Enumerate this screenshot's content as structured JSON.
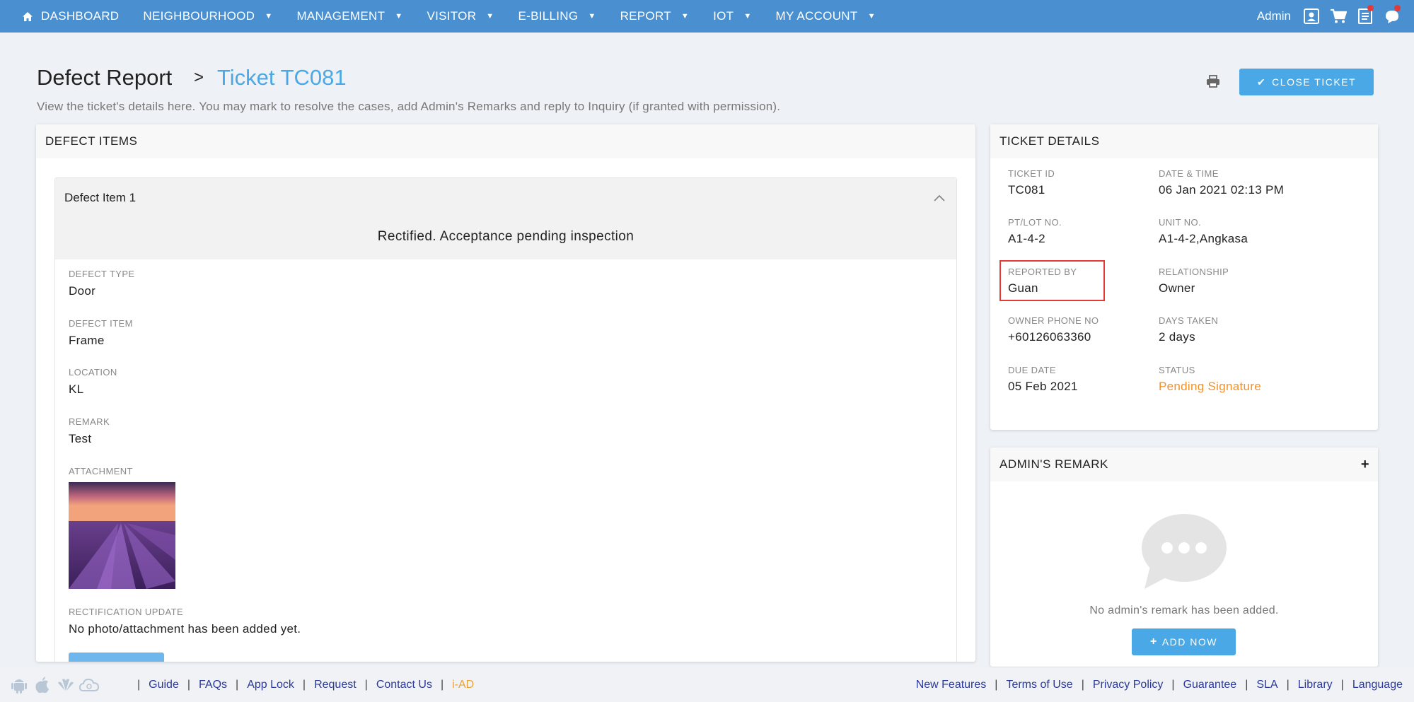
{
  "nav": {
    "home_icon": "home-icon",
    "items": [
      {
        "label": "DASHBOARD",
        "caret": false
      },
      {
        "label": "NEIGHBOURHOOD",
        "caret": true
      },
      {
        "label": "MANAGEMENT",
        "caret": true
      },
      {
        "label": "VISITOR",
        "caret": true
      },
      {
        "label": "E-BILLING",
        "caret": true
      },
      {
        "label": "REPORT",
        "caret": true
      },
      {
        "label": "IOT",
        "caret": true
      },
      {
        "label": "MY ACCOUNT",
        "caret": true
      }
    ],
    "admin_label": "Admin",
    "colors": {
      "bar": "#4a8fd0",
      "notification": "#e53935"
    }
  },
  "header": {
    "title": "Defect Report",
    "separator": ">",
    "ticket_title": "Ticket TC081",
    "description": "View the ticket's details here. You may mark to resolve the cases, add Admin's Remarks and reply to Inquiry (if granted with permission).",
    "close_button": "CLOSE TICKET",
    "accent": "#4aa8e6"
  },
  "defect": {
    "section_title": "DEFECT ITEMS",
    "item_title": "Defect Item 1",
    "status_text": "Rectified. Acceptance pending inspection",
    "fields": [
      {
        "label": "DEFECT TYPE",
        "value": "Door"
      },
      {
        "label": "DEFECT ITEM",
        "value": "Frame"
      },
      {
        "label": "LOCATION",
        "value": "KL"
      },
      {
        "label": "REMARK",
        "value": "Test"
      }
    ],
    "attachment_label": "ATTACHMENT",
    "rectification_label": "RECTIFICATION UPDATE",
    "rectification_value": "No photo/attachment has been added yet."
  },
  "ticket": {
    "section_title": "TICKET DETAILS",
    "fields": [
      {
        "label": "TICKET ID",
        "value": "TC081"
      },
      {
        "label": "DATE & TIME",
        "value": "06 Jan 2021 02:13 PM"
      },
      {
        "label": "PT/LOT NO.",
        "value": "A1-4-2"
      },
      {
        "label": "UNIT NO.",
        "value": "A1-4-2,Angkasa"
      },
      {
        "label": "REPORTED BY",
        "value": "Guan"
      },
      {
        "label": "RELATIONSHIP",
        "value": "Owner"
      },
      {
        "label": "OWNER PHONE NO",
        "value": "+60126063360"
      },
      {
        "label": "DAYS TAKEN",
        "value": "2 days"
      },
      {
        "label": "DUE DATE",
        "value": "05 Feb 2021"
      },
      {
        "label": "STATUS",
        "value": "Pending Signature"
      }
    ],
    "status_color": "#f0932b",
    "highlight_color": "#e53935"
  },
  "remark": {
    "section_title": "ADMIN'S REMARK",
    "plus": "+",
    "empty_text": "No admin's remark has been added.",
    "add_button": "ADD NOW"
  },
  "footer": {
    "os_icons": [
      "android-icon",
      "apple-icon",
      "huawei-icon",
      "cloud-icon"
    ],
    "left_links": [
      "Guide",
      "FAQs",
      "App Lock",
      "Request",
      "Contact Us",
      "i-AD"
    ],
    "right_links": [
      "New Features",
      "Terms of Use",
      "Privacy Policy",
      "Guarantee",
      "SLA",
      "Library",
      "Language"
    ],
    "separator": "|"
  }
}
